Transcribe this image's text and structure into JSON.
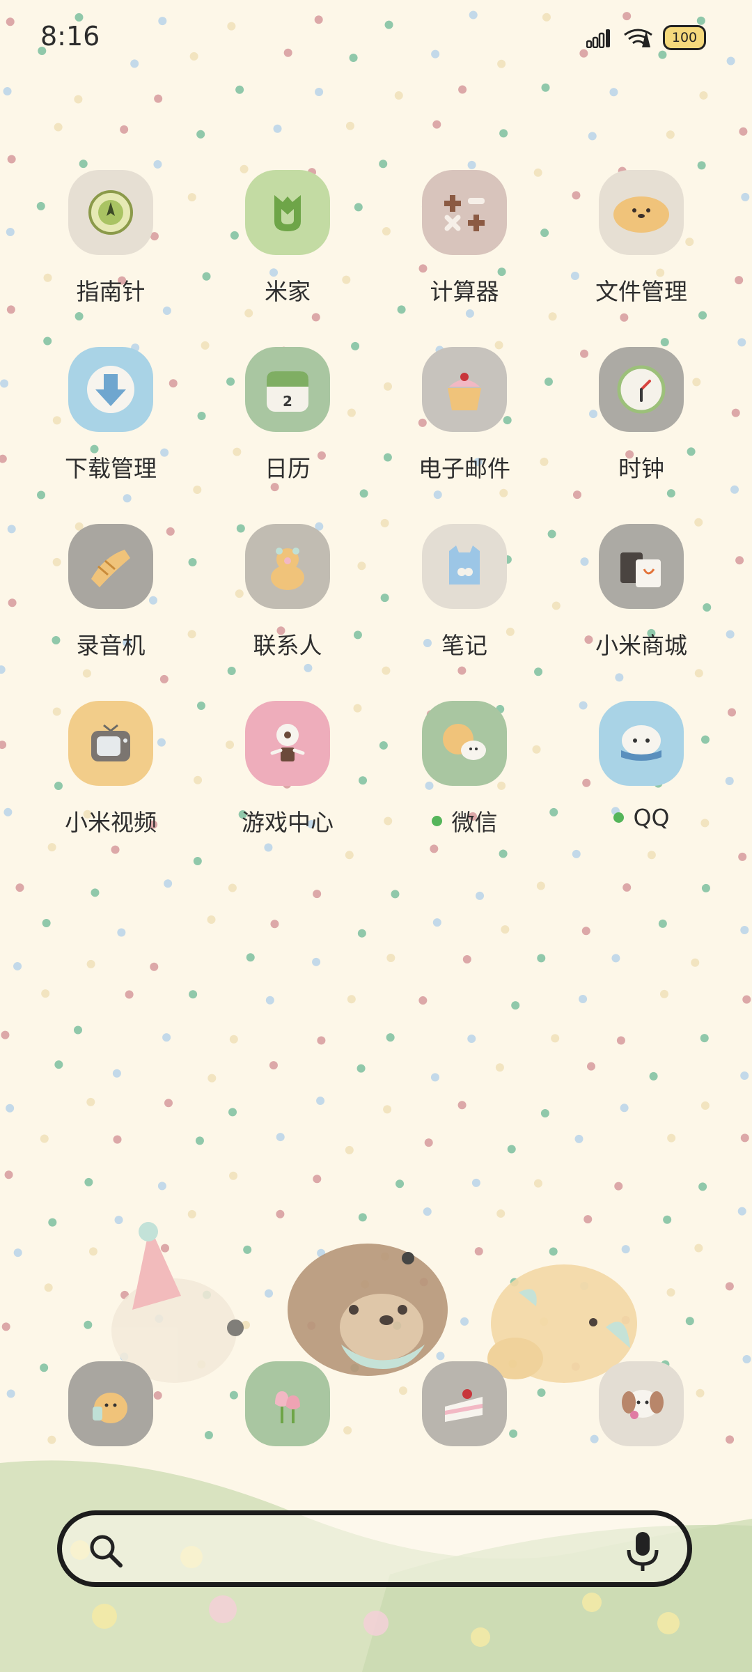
{
  "status_bar": {
    "time": "8:16",
    "battery": "100",
    "icons": [
      "signal-icon",
      "wifi-icon",
      "battery-icon"
    ]
  },
  "apps": [
    {
      "label": "指南针",
      "icon": "compass-icon",
      "bg": "#e6dfd3"
    },
    {
      "label": "米家",
      "icon": "mijia-icon",
      "bg": "#c3dba3"
    },
    {
      "label": "计算器",
      "icon": "calculator-icon",
      "bg": "#d8c4bc"
    },
    {
      "label": "文件管理",
      "icon": "file-manager-icon",
      "bg": "#e6dfd3"
    },
    {
      "label": "下载管理",
      "icon": "download-icon",
      "bg": "#a9d3e6"
    },
    {
      "label": "日历",
      "icon": "calendar-icon",
      "bg": "#a9c6a1"
    },
    {
      "label": "电子邮件",
      "icon": "email-icon",
      "bg": "#c7c3bd"
    },
    {
      "label": "时钟",
      "icon": "clock-icon",
      "bg": "#acaaa4"
    },
    {
      "label": "录音机",
      "icon": "recorder-icon",
      "bg": "#a9a6a0"
    },
    {
      "label": "联系人",
      "icon": "contacts-icon",
      "bg": "#c1bcb2"
    },
    {
      "label": "笔记",
      "icon": "notes-icon",
      "bg": "#e3ddd3"
    },
    {
      "label": "小米商城",
      "icon": "mi-store-icon",
      "bg": "#acaaa4"
    },
    {
      "label": "小米视频",
      "icon": "mi-video-icon",
      "bg": "#f2cd8a"
    },
    {
      "label": "游戏中心",
      "icon": "game-center-icon",
      "bg": "#eeadbb"
    },
    {
      "label": "微信",
      "icon": "wechat-icon",
      "bg": "#a9c6a1",
      "dot": true
    },
    {
      "label": "QQ",
      "icon": "qq-icon",
      "bg": "#a9d3e6",
      "dot": true
    }
  ],
  "dock": [
    {
      "icon": "dog-phone-icon",
      "bg": "#a9a6a0"
    },
    {
      "icon": "tulip-icon",
      "bg": "#a9c6a1"
    },
    {
      "icon": "cake-icon",
      "bg": "#b9b5ae"
    },
    {
      "icon": "puppy-camera-icon",
      "bg": "#e3ddd3"
    }
  ],
  "colors": {
    "new_dot": "#55b55a",
    "wallpaper": "#fdf7e8"
  }
}
